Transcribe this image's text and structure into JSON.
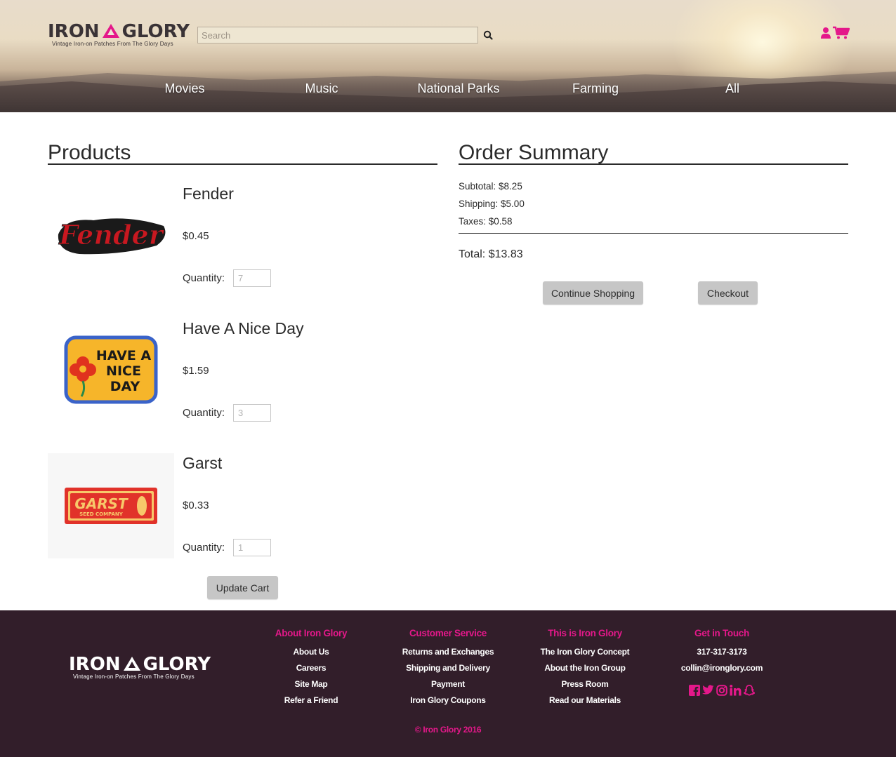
{
  "brand": {
    "name_left": "IRON",
    "name_right": "GLORY",
    "tagline": "Vintage Iron-on Patches From The Glory Days",
    "accent_color": "#e4188a"
  },
  "header": {
    "search": {
      "placeholder": "Search",
      "value": ""
    },
    "nav": [
      "Movies",
      "Music",
      "National Parks",
      "Farming",
      "All"
    ],
    "icons": [
      "user-icon",
      "cart-icon",
      "search-icon"
    ]
  },
  "products": {
    "title": "Products",
    "items": [
      {
        "name": "Fender",
        "price": "$0.45",
        "qty_label": "Quantity:",
        "qty": "7",
        "patch_text": "Fender"
      },
      {
        "name": "Have A Nice Day",
        "price": "$1.59",
        "qty_label": "Quantity:",
        "qty": "3",
        "patch_text": [
          "HAVE A",
          "NICE",
          "DAY"
        ]
      },
      {
        "name": "Garst",
        "price": "$0.33",
        "qty_label": "Quantity:",
        "qty": "1",
        "patch_text": [
          "GARST",
          "SEED COMPANY"
        ]
      }
    ],
    "update_label": "Update Cart"
  },
  "summary": {
    "title": "Order Summary",
    "subtotal": "Subtotal: $8.25",
    "shipping": "Shipping: $5.00",
    "taxes": "Taxes: $0.58",
    "total": "Total: $13.83",
    "continue_label": "Continue Shopping",
    "checkout_label": "Checkout"
  },
  "footer": {
    "columns": [
      {
        "heading": "About Iron Glory",
        "links": [
          "About Us",
          "Careers",
          "Site Map",
          "Refer a Friend"
        ]
      },
      {
        "heading": "Customer Service",
        "links": [
          "Returns and Exchanges",
          "Shipping and Delivery",
          "Payment",
          "Iron Glory Coupons"
        ]
      },
      {
        "heading": "This is Iron Glory",
        "links": [
          "The Iron Glory Concept",
          "About the Iron Group",
          "Press Room",
          "Read our Materials"
        ]
      },
      {
        "heading": "Get in Touch",
        "links": [
          "317-317-3173",
          "collin@ironglory.com"
        ]
      }
    ],
    "social_icons": [
      "facebook-icon",
      "twitter-icon",
      "instagram-icon",
      "linkedin-icon",
      "snapchat-icon"
    ],
    "copyright": "© Iron Glory 2016",
    "background": "#321e2a"
  }
}
